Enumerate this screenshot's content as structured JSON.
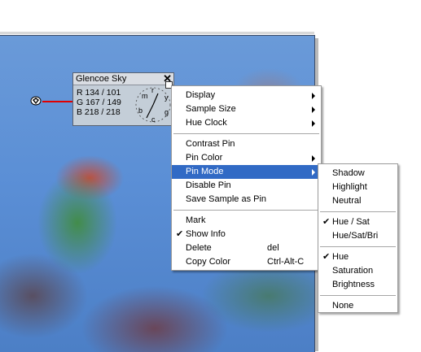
{
  "pin_panel": {
    "title": "Glencoe Sky",
    "close_label": "✕",
    "r_line": "R 134 / 101",
    "g_line": "G 167 / 149",
    "b_line": "B 218 / 218",
    "clock_letters": [
      "m",
      "r",
      "y",
      "g",
      "c",
      "b"
    ]
  },
  "context_menu": {
    "items": [
      {
        "label": "Display",
        "submenu": true
      },
      {
        "label": "Sample Size",
        "submenu": true
      },
      {
        "label": "Hue Clock",
        "submenu": true
      },
      {
        "label": "Contrast Pin"
      },
      {
        "label": "Pin Color",
        "submenu": true
      },
      {
        "label": "Pin Mode",
        "submenu": true,
        "selected": true
      },
      {
        "label": "Disable Pin"
      },
      {
        "label": "Save Sample as Pin"
      },
      {
        "label": "Mark"
      },
      {
        "label": "Show Info",
        "checked": true
      },
      {
        "label": "Delete",
        "shortcut": "del"
      },
      {
        "label": "Copy Color",
        "shortcut": "Ctrl-Alt-C"
      }
    ]
  },
  "pin_mode_submenu": {
    "items": [
      {
        "label": "Shadow"
      },
      {
        "label": "Highlight"
      },
      {
        "label": "Neutral"
      },
      {
        "label": "Hue / Sat",
        "checked": true
      },
      {
        "label": "Hue/Sat/Bri"
      },
      {
        "label": "Hue",
        "checked": true
      },
      {
        "label": "Saturation"
      },
      {
        "label": "Brightness"
      },
      {
        "label": "None"
      }
    ]
  },
  "check_glyph": "✔",
  "colors": {
    "selection": "#316ac5",
    "pin_line": "#e00000",
    "sky": "#5b8fd6"
  }
}
